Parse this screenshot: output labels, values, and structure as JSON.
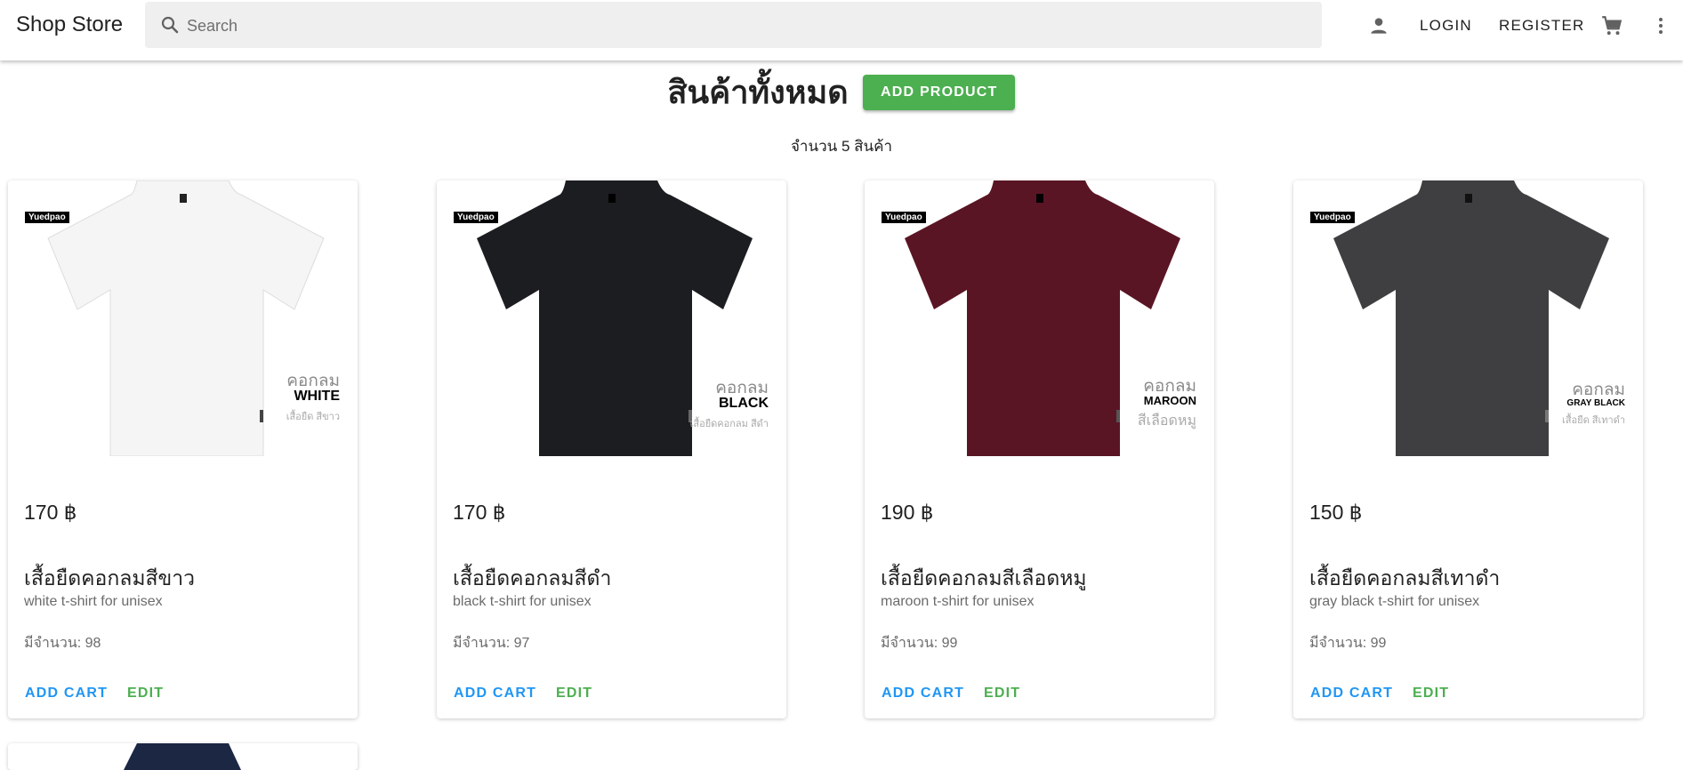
{
  "appbar": {
    "brand": "Shop Store",
    "search_placeholder": "Search",
    "login_label": "LOGIN",
    "register_label": "REGISTER",
    "icons": [
      "account-icon",
      "cart-icon",
      "more-vert-icon"
    ]
  },
  "header": {
    "title": "สินค้าทั้งหมด",
    "add_product_label": "ADD PRODUCT",
    "count_text": "จำนวน 5 สินค้า"
  },
  "colors": {
    "primary_blue": "#2196f3",
    "success_green": "#4caf50"
  },
  "products": [
    {
      "brand_tag": "Yuedpao",
      "img_line1": "คอกลม",
      "img_line2": "WHITE",
      "img_line3": "เสื้อยืด สีขาว",
      "shirt_color": "#f5f5f5",
      "price": "170 ฿",
      "name": "เสื้อยืดคอกลมสีขาว",
      "description": "white t-shirt for unisex",
      "stock": "มีจำนวน: 98",
      "add_cart_label": "ADD CART",
      "edit_label": "EDIT"
    },
    {
      "brand_tag": "Yuedpao",
      "img_line1": "คอกลม",
      "img_line2": "BLACK",
      "img_line3": "เสื้อยืดคอกลม สีดำ",
      "shirt_color": "#1c1d21",
      "price": "170 ฿",
      "name": "เสื้อยืดคอกลมสีดำ",
      "description": "black t-shirt for unisex",
      "stock": "มีจำนวน: 97",
      "add_cart_label": "ADD CART",
      "edit_label": "EDIT"
    },
    {
      "brand_tag": "Yuedpao",
      "img_line1": "คอกลม",
      "img_line2": "MAROON",
      "img_line3": "สีเลือดหมู",
      "shirt_color": "#5a1524",
      "price": "190 ฿",
      "name": "เสื้อยืดคอกลมสีเลือดหมู",
      "description": "maroon t-shirt for unisex",
      "stock": "มีจำนวน: 99",
      "add_cart_label": "ADD CART",
      "edit_label": "EDIT"
    },
    {
      "brand_tag": "Yuedpao",
      "img_line1": "คอกลม",
      "img_line2": "GRAY BLACK",
      "img_line3": "เสื้อยืด สีเทาดำ",
      "shirt_color": "#3f3f41",
      "price": "150 ฿",
      "name": "เสื้อยืดคอกลมสีเทาดำ",
      "description": "gray black t-shirt for unisex",
      "stock": "มีจำนวน: 99",
      "add_cart_label": "ADD CART",
      "edit_label": "EDIT"
    },
    {
      "shirt_color": "#1c2744"
    }
  ]
}
